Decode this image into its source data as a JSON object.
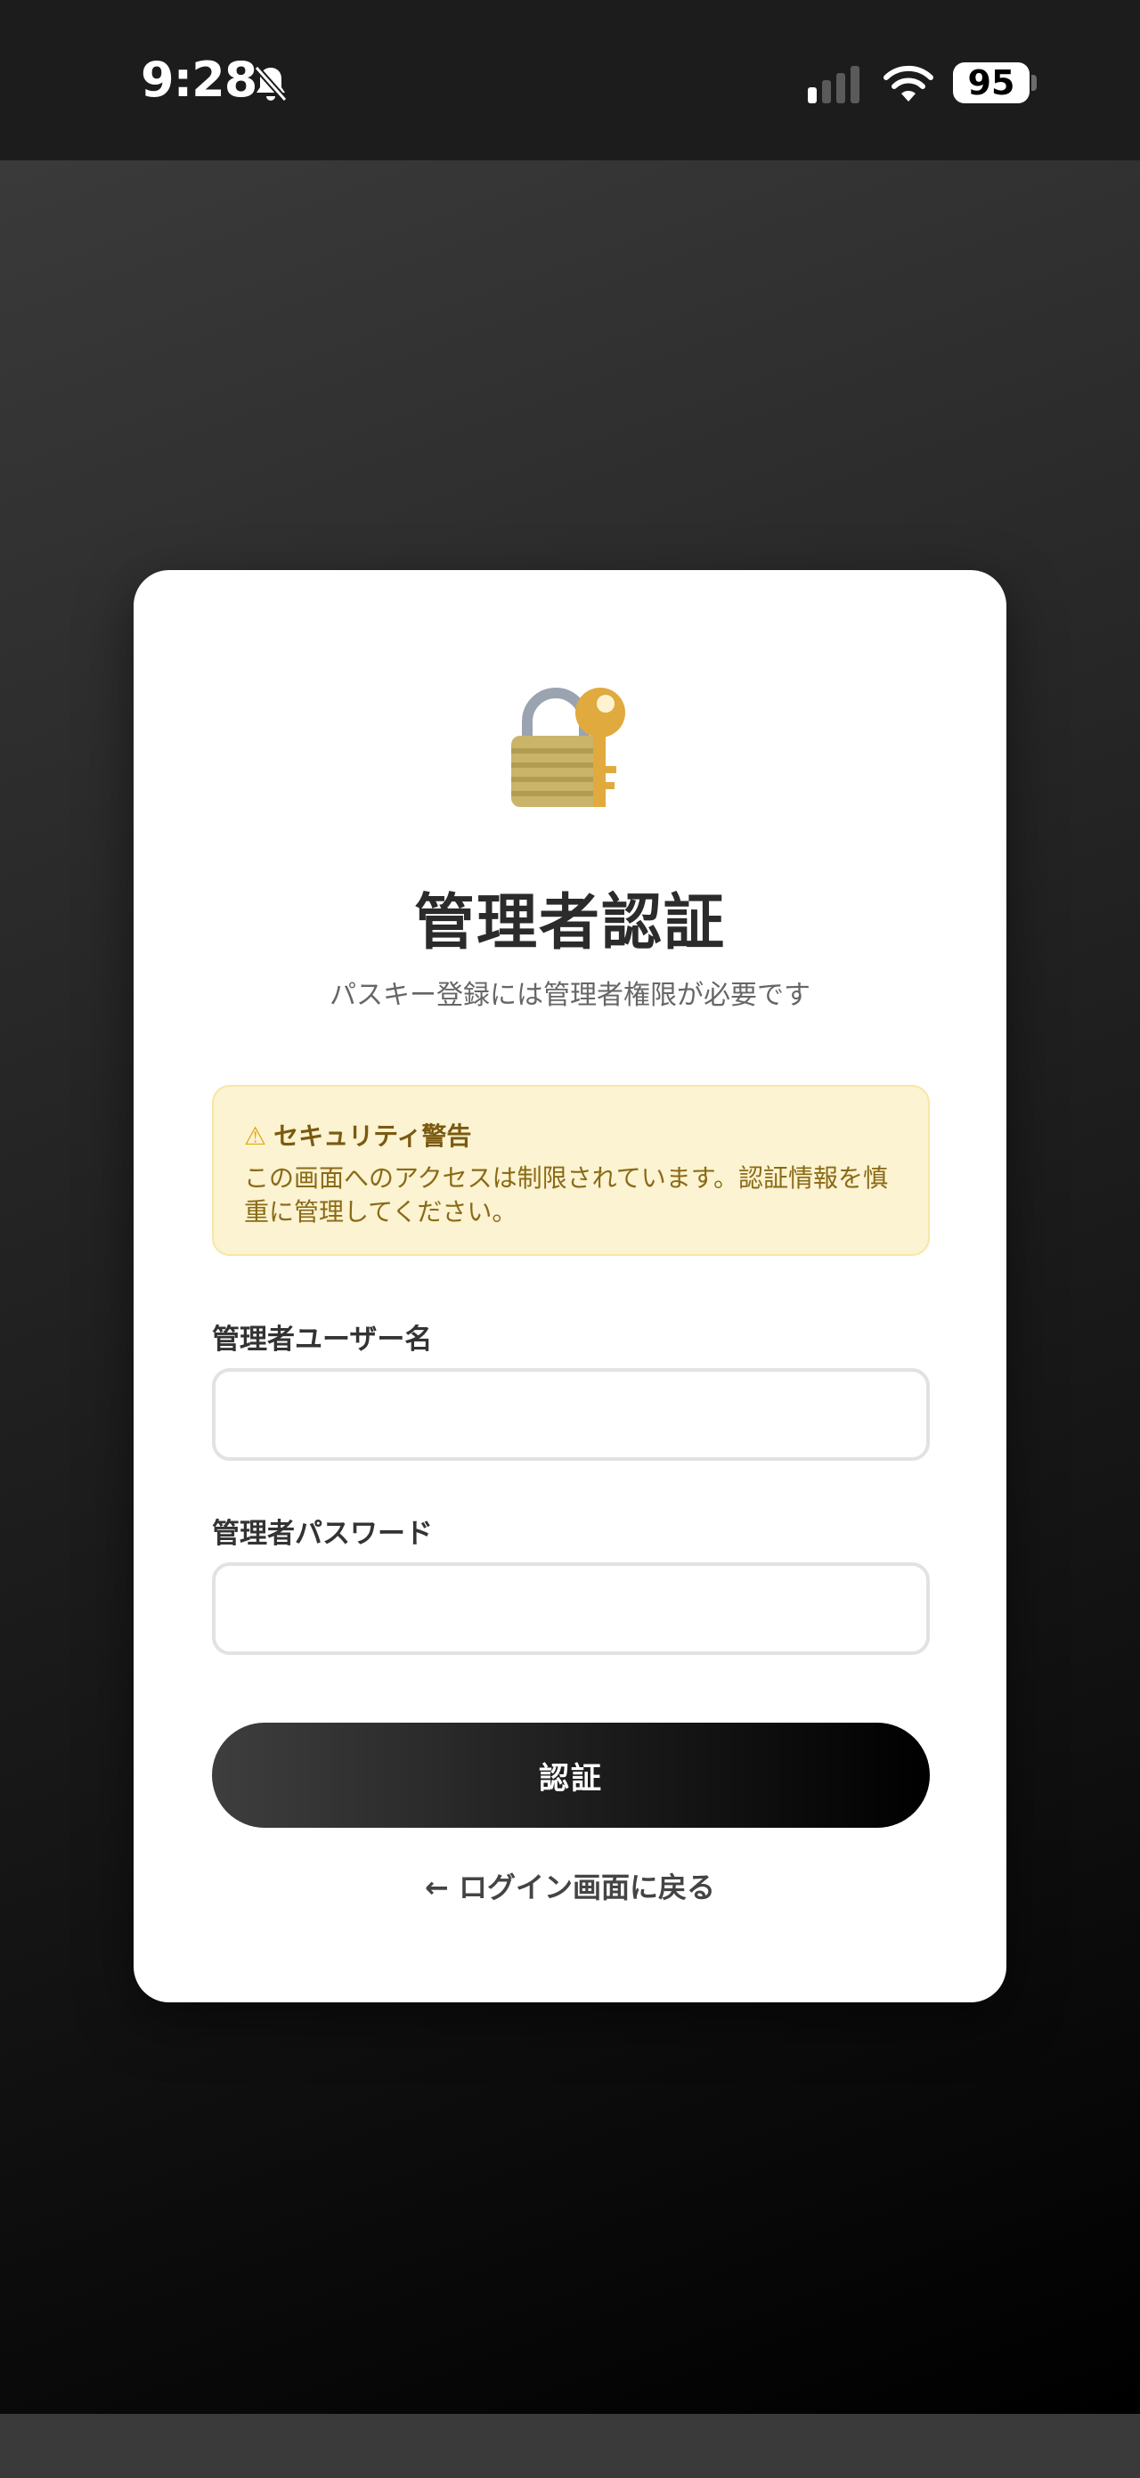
{
  "status_bar": {
    "time": "9:28",
    "battery_level": "95",
    "icons": [
      "bell-slash-icon",
      "signal-icon",
      "wifi-icon",
      "battery-icon"
    ]
  },
  "card": {
    "icon": "lock-with-key-icon",
    "title": "管理者認証",
    "subtitle": "パスキー登録には管理者権限が必要です"
  },
  "warning": {
    "icon": "warning-icon",
    "title": "セキュリティ警告",
    "text": "この画面へのアクセスは制限されています。認証情報を慎重に管理してください。"
  },
  "form": {
    "username_label": "管理者ユーザー名",
    "username_value": "",
    "password_label": "管理者パスワード",
    "password_value": "",
    "submit_label": "認証"
  },
  "back_link": {
    "label": "← ログイン画面に戻る"
  },
  "colors": {
    "warning_bg": "#fbf3d1",
    "warning_text": "#8a6a16",
    "button_dark": "#000000"
  }
}
